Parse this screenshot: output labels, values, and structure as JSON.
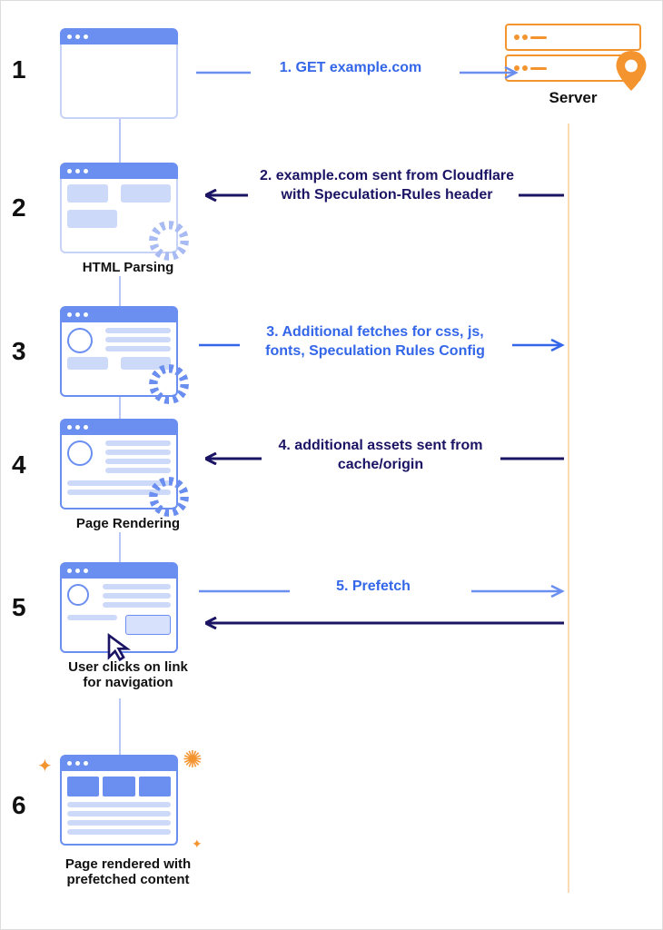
{
  "steps": {
    "s1": {
      "num": "1",
      "caption": "",
      "arrow": "1. GET example.com"
    },
    "s2": {
      "num": "2",
      "caption": "HTML Parsing",
      "arrow": "2. example.com sent from Cloudflare with Speculation-Rules header"
    },
    "s3": {
      "num": "3",
      "caption": "",
      "arrow": "3. Additional fetches for css, js, fonts, Speculation Rules Config"
    },
    "s4": {
      "num": "4",
      "caption": "Page Rendering",
      "arrow": "4. additional assets sent from cache/origin"
    },
    "s5": {
      "num": "5",
      "caption": "User clicks on link for navigation",
      "arrow": "5. Prefetch"
    },
    "s6": {
      "num": "6",
      "caption": "Page rendered with prefetched content"
    }
  },
  "server_label": "Server",
  "colors": {
    "blue": "#3366e8",
    "dark": "#1b1464",
    "orange": "#f4942f",
    "lightblue": "#b8c7f5"
  }
}
